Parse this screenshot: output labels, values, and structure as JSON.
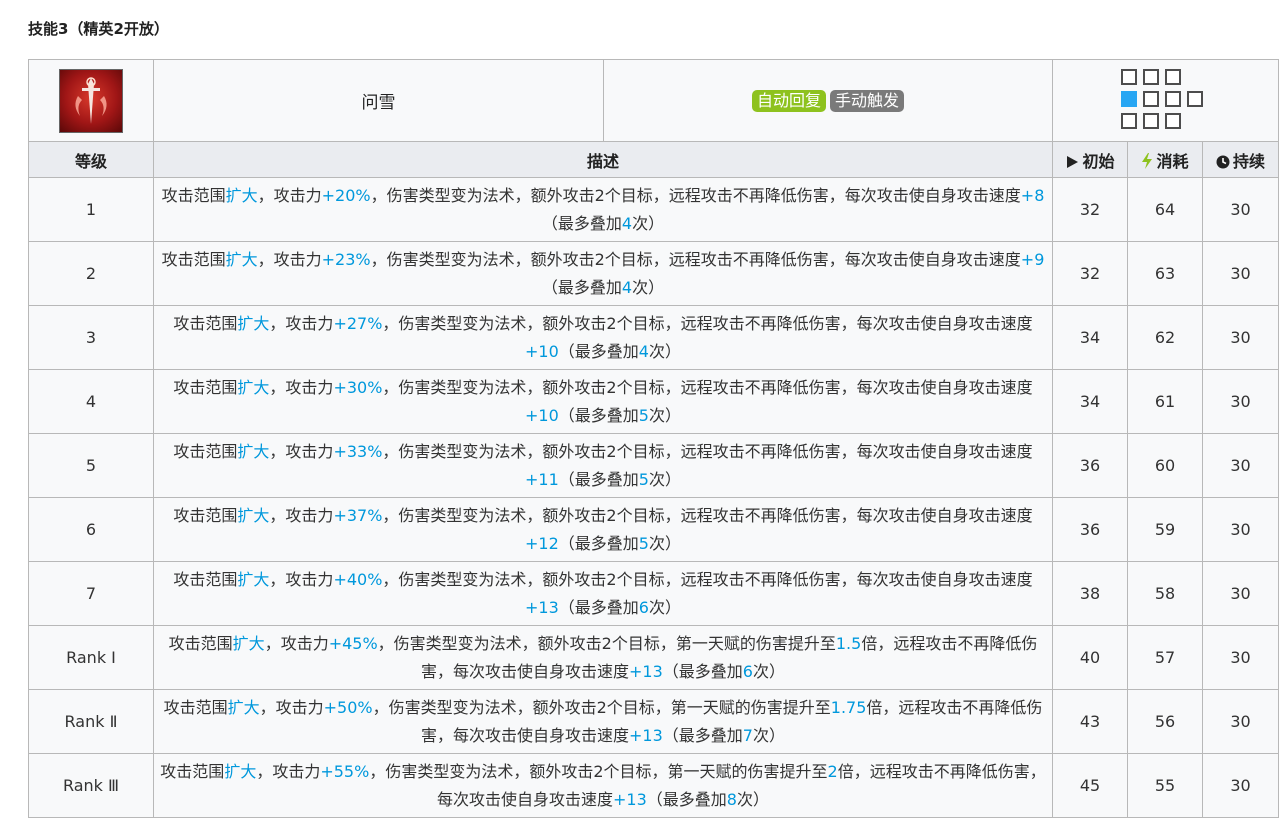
{
  "section_title": "技能3（精英2开放）",
  "skill": {
    "icon": "skill-icon",
    "name": "问雪",
    "tags": [
      "自动回复",
      "手动触发"
    ]
  },
  "colors": {
    "highlight": "#0098dc",
    "tag_auto": "#8ec21e",
    "tag_manual": "#7a7a7a",
    "range_self": "#27a6f3"
  },
  "headers": {
    "level": "等级",
    "description": "描述",
    "initial": "初始",
    "cost": "消耗",
    "duration": "持续"
  },
  "levels": [
    {
      "level": "1",
      "desc": [
        [
          "攻击范围",
          0
        ],
        [
          "扩大",
          1
        ],
        [
          "，攻击力",
          0
        ],
        [
          "+20%",
          1
        ],
        [
          "，伤害类型变为法术，额外攻击2个目标，远程攻击不再降低伤害，每次攻击使自身攻击速度",
          0
        ],
        [
          "+8",
          1
        ],
        [
          "（最多叠加",
          0
        ],
        [
          "4",
          1
        ],
        [
          "次）",
          0
        ]
      ],
      "initial": "32",
      "cost": "64",
      "duration": "30"
    },
    {
      "level": "2",
      "desc": [
        [
          "攻击范围",
          0
        ],
        [
          "扩大",
          1
        ],
        [
          "，攻击力",
          0
        ],
        [
          "+23%",
          1
        ],
        [
          "，伤害类型变为法术，额外攻击2个目标，远程攻击不再降低伤害，每次攻击使自身攻击速度",
          0
        ],
        [
          "+9",
          1
        ],
        [
          "（最多叠加",
          0
        ],
        [
          "4",
          1
        ],
        [
          "次）",
          0
        ]
      ],
      "initial": "32",
      "cost": "63",
      "duration": "30"
    },
    {
      "level": "3",
      "desc": [
        [
          "攻击范围",
          0
        ],
        [
          "扩大",
          1
        ],
        [
          "，攻击力",
          0
        ],
        [
          "+27%",
          1
        ],
        [
          "，伤害类型变为法术，额外攻击2个目标，远程攻击不再降低伤害，每次攻击使自身攻击速度",
          0
        ],
        [
          "+10",
          1
        ],
        [
          "（最多叠加",
          0
        ],
        [
          "4",
          1
        ],
        [
          "次）",
          0
        ]
      ],
      "initial": "34",
      "cost": "62",
      "duration": "30"
    },
    {
      "level": "4",
      "desc": [
        [
          "攻击范围",
          0
        ],
        [
          "扩大",
          1
        ],
        [
          "，攻击力",
          0
        ],
        [
          "+30%",
          1
        ],
        [
          "，伤害类型变为法术，额外攻击2个目标，远程攻击不再降低伤害，每次攻击使自身攻击速度",
          0
        ],
        [
          "+10",
          1
        ],
        [
          "（最多叠加",
          0
        ],
        [
          "5",
          1
        ],
        [
          "次）",
          0
        ]
      ],
      "initial": "34",
      "cost": "61",
      "duration": "30"
    },
    {
      "level": "5",
      "desc": [
        [
          "攻击范围",
          0
        ],
        [
          "扩大",
          1
        ],
        [
          "，攻击力",
          0
        ],
        [
          "+33%",
          1
        ],
        [
          "，伤害类型变为法术，额外攻击2个目标，远程攻击不再降低伤害，每次攻击使自身攻击速度",
          0
        ],
        [
          "+11",
          1
        ],
        [
          "（最多叠加",
          0
        ],
        [
          "5",
          1
        ],
        [
          "次）",
          0
        ]
      ],
      "initial": "36",
      "cost": "60",
      "duration": "30"
    },
    {
      "level": "6",
      "desc": [
        [
          "攻击范围",
          0
        ],
        [
          "扩大",
          1
        ],
        [
          "，攻击力",
          0
        ],
        [
          "+37%",
          1
        ],
        [
          "，伤害类型变为法术，额外攻击2个目标，远程攻击不再降低伤害，每次攻击使自身攻击速度",
          0
        ],
        [
          "+12",
          1
        ],
        [
          "（最多叠加",
          0
        ],
        [
          "5",
          1
        ],
        [
          "次）",
          0
        ]
      ],
      "initial": "36",
      "cost": "59",
      "duration": "30"
    },
    {
      "level": "7",
      "desc": [
        [
          "攻击范围",
          0
        ],
        [
          "扩大",
          1
        ],
        [
          "，攻击力",
          0
        ],
        [
          "+40%",
          1
        ],
        [
          "，伤害类型变为法术，额外攻击2个目标，远程攻击不再降低伤害，每次攻击使自身攻击速度",
          0
        ],
        [
          "+13",
          1
        ],
        [
          "（最多叠加",
          0
        ],
        [
          "6",
          1
        ],
        [
          "次）",
          0
        ]
      ],
      "initial": "38",
      "cost": "58",
      "duration": "30"
    },
    {
      "level": "Rank Ⅰ",
      "desc": [
        [
          "攻击范围",
          0
        ],
        [
          "扩大",
          1
        ],
        [
          "，攻击力",
          0
        ],
        [
          "+45%",
          1
        ],
        [
          "，伤害类型变为法术，额外攻击2个目标，第一天赋的伤害提升至",
          0
        ],
        [
          "1.5",
          1
        ],
        [
          "倍，远程攻击不再降低伤害，每次攻击使自身攻击速度",
          0
        ],
        [
          "+13",
          1
        ],
        [
          "（最多叠加",
          0
        ],
        [
          "6",
          1
        ],
        [
          "次）",
          0
        ]
      ],
      "initial": "40",
      "cost": "57",
      "duration": "30"
    },
    {
      "level": "Rank Ⅱ",
      "desc": [
        [
          "攻击范围",
          0
        ],
        [
          "扩大",
          1
        ],
        [
          "，攻击力",
          0
        ],
        [
          "+50%",
          1
        ],
        [
          "，伤害类型变为法术，额外攻击2个目标，第一天赋的伤害提升至",
          0
        ],
        [
          "1.75",
          1
        ],
        [
          "倍，远程攻击不再降低伤害，每次攻击使自身攻击速度",
          0
        ],
        [
          "+13",
          1
        ],
        [
          "（最多叠加",
          0
        ],
        [
          "7",
          1
        ],
        [
          "次）",
          0
        ]
      ],
      "initial": "43",
      "cost": "56",
      "duration": "30"
    },
    {
      "level": "Rank Ⅲ",
      "desc": [
        [
          "攻击范围",
          0
        ],
        [
          "扩大",
          1
        ],
        [
          "，攻击力",
          0
        ],
        [
          "+55%",
          1
        ],
        [
          "，伤害类型变为法术，额外攻击2个目标，第一天赋的伤害提升至",
          0
        ],
        [
          "2",
          1
        ],
        [
          "倍，远程攻击不再降低伤害，每次攻击使自身攻击速度",
          0
        ],
        [
          "+13",
          1
        ],
        [
          "（最多叠加",
          0
        ],
        [
          "8",
          1
        ],
        [
          "次）",
          0
        ]
      ],
      "initial": "45",
      "cost": "55",
      "duration": "30"
    }
  ]
}
